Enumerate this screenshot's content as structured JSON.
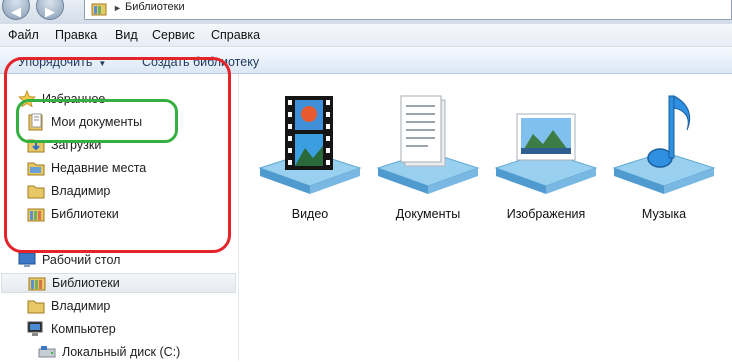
{
  "address": {
    "crumb": "Библиотеки"
  },
  "menu": [
    "Файл",
    "Правка",
    "Вид",
    "Сервис",
    "Справка"
  ],
  "commands": {
    "organize": "Упорядочить",
    "create_library": "Создать библиотеку"
  },
  "favorites": {
    "header": "Избранное",
    "items": [
      "Мои документы",
      "Загрузки",
      "Недавние места",
      "Владимир",
      "Библиотеки"
    ]
  },
  "tree": {
    "desktop": "Рабочий стол",
    "libraries": "Библиотеки",
    "user": "Владимир",
    "computer": "Компьютер",
    "local_disk": "Локальный диск (C:)"
  },
  "libraries": [
    "Видео",
    "Документы",
    "Изображения",
    "Музыка"
  ],
  "annotations": {
    "outer_color": "#e5232b",
    "inner_color": "#35b040"
  }
}
